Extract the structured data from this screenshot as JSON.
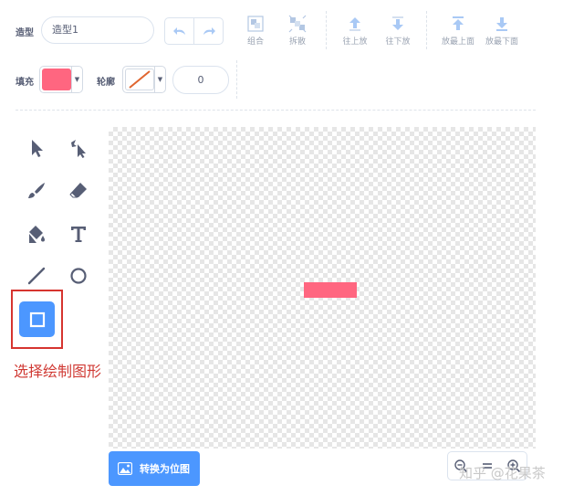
{
  "toolbar": {
    "costume_label": "造型",
    "costume_name": "造型1",
    "group_label": "组合",
    "ungroup_label": "拆散",
    "forward_label": "往上放",
    "backward_label": "往下放",
    "front_label": "放最上面",
    "back_label": "放最下面",
    "fill_label": "填充",
    "outline_label": "轮廓",
    "outline_width": "0",
    "fill_color": "#ff6680",
    "accent": "#4c97ff"
  },
  "palette": {
    "tools": [
      "select-icon",
      "reshape-icon",
      "brush-icon",
      "eraser-icon",
      "fill-icon",
      "text-icon",
      "line-icon",
      "circle-icon",
      "rectangle-icon"
    ],
    "selected": "rectangle-icon"
  },
  "annotation": {
    "text": "选择绘制图形",
    "color": "#d03a34"
  },
  "canvas": {
    "shape_color": "#ff6680"
  },
  "footer": {
    "convert_label": "转换为位图",
    "zoom_out": "zoom-out-icon",
    "zoom_reset": "zoom-reset-icon",
    "zoom_in": "zoom-in-icon"
  },
  "watermark": "知乎 @花果茶"
}
